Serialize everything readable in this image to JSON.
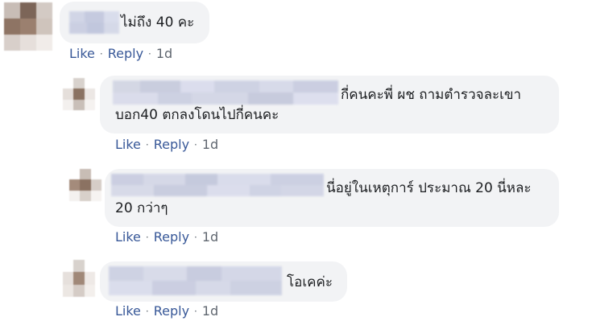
{
  "comments": [
    {
      "text_line1": "ไม่ถึง 40 คะ",
      "text_line2": "",
      "actions": {
        "like": "Like",
        "reply": "Reply",
        "time": "1d"
      }
    },
    {
      "text_line1": "กี่คนคะพี่ ผช ถามตำรวจละเขา",
      "text_line2": "บอก40 ตกลงโดนไปกี่คนคะ",
      "actions": {
        "like": "Like",
        "reply": "Reply",
        "time": "1d"
      }
    },
    {
      "text_line1": "นี่อยู่ในเหตุการ์ ประมาณ 20 นี่หละ",
      "text_line2": "20 กว่าๆ",
      "actions": {
        "like": "Like",
        "reply": "Reply",
        "time": "1d"
      }
    },
    {
      "text_line1": "โอเคค่ะ",
      "text_line2": "",
      "actions": {
        "like": "Like",
        "reply": "Reply",
        "time": "1d"
      }
    }
  ],
  "separator": "·"
}
